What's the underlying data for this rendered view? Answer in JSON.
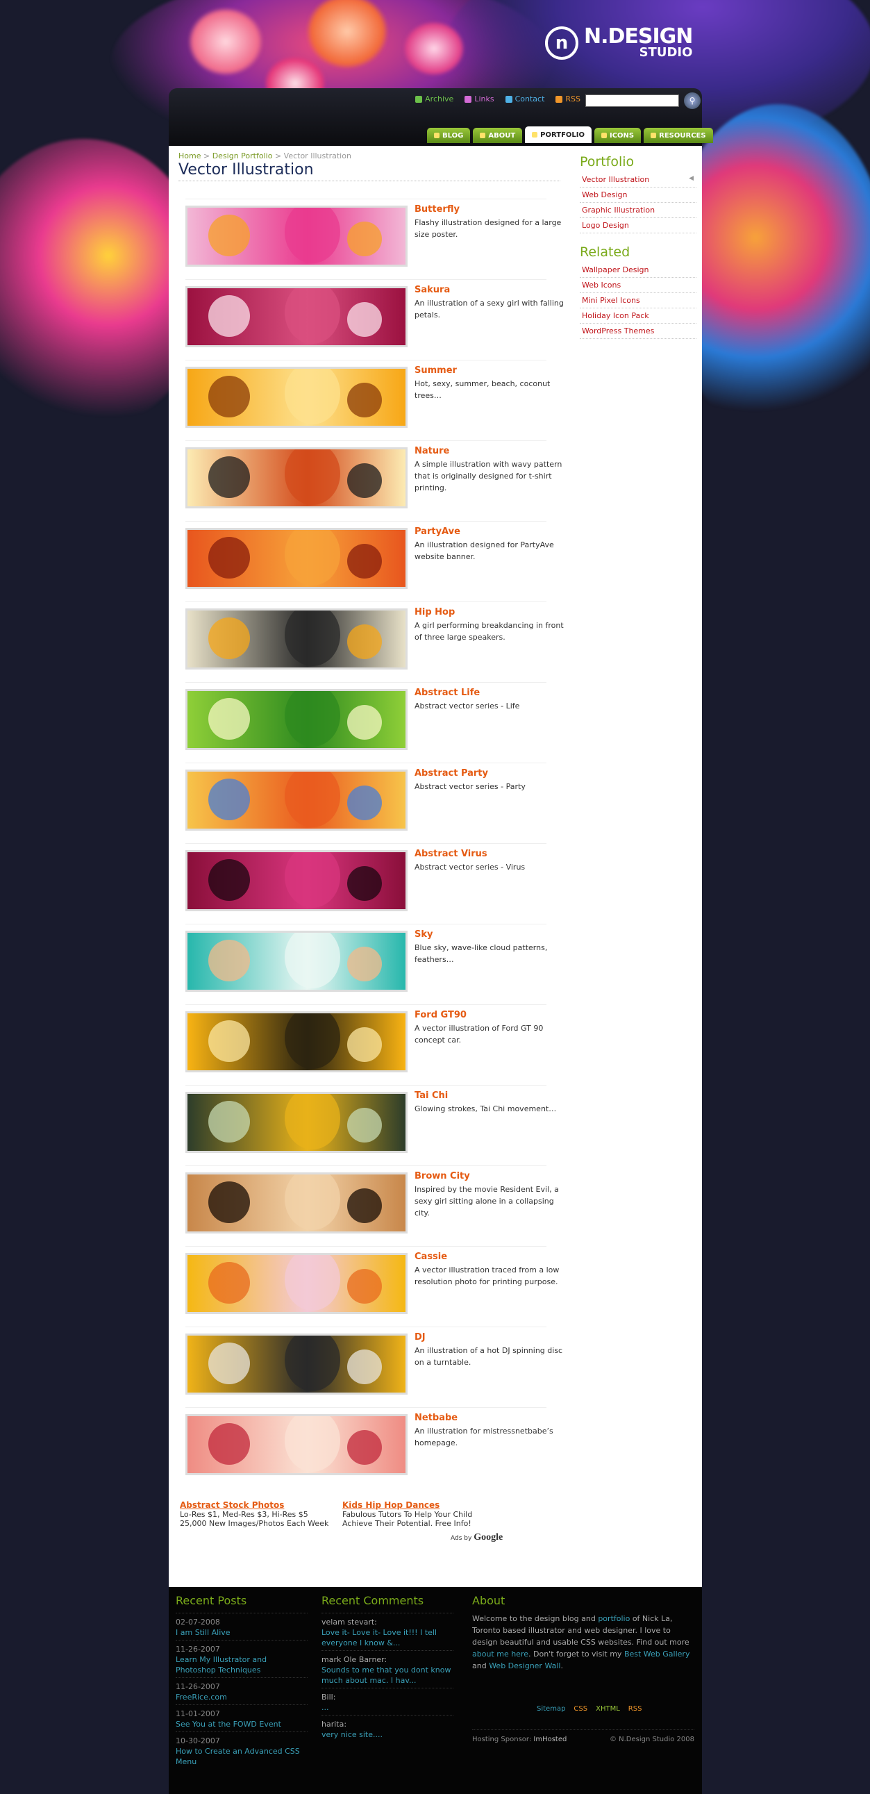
{
  "brand": {
    "name_line1": "N.DESIGN",
    "name_line2": "STUDIO",
    "mark": "n"
  },
  "toplinks": [
    {
      "label": "Archive",
      "icon": "archive-icon",
      "color": "#6cc04a"
    },
    {
      "label": "Links",
      "icon": "links-icon",
      "color": "#d36bd6"
    },
    {
      "label": "Contact",
      "icon": "contact-icon",
      "color": "#4fb1e6"
    },
    {
      "label": "RSS",
      "icon": "rss-icon",
      "color": "#f0962a"
    }
  ],
  "search": {
    "placeholder": ""
  },
  "tabs": [
    {
      "label": "BLOG",
      "active": false
    },
    {
      "label": "ABOUT",
      "active": false
    },
    {
      "label": "PORTFOLIO",
      "active": true
    },
    {
      "label": "ICONS",
      "active": false
    },
    {
      "label": "RESOURCES",
      "active": false
    }
  ],
  "breadcrumb": {
    "home": "Home",
    "sep": ">",
    "section": "Design Portfolio",
    "current": "Vector Illustration"
  },
  "page_title": "Vector Illustration",
  "items": [
    {
      "title": "Butterfly",
      "desc": "Flashy illustration designed for a large size poster.",
      "colors": [
        "#f2b7d6",
        "#ea3b8f",
        "#f7a12a"
      ]
    },
    {
      "title": "Sakura",
      "desc": "An illustration of a sexy girl with falling petals.",
      "colors": [
        "#9b1140",
        "#d94f7f",
        "#fbe0ea"
      ]
    },
    {
      "title": "Summer",
      "desc": "Hot, sexy, summer, beach, coconut trees…",
      "colors": [
        "#f7a716",
        "#fde08c",
        "#8c3d09"
      ]
    },
    {
      "title": "Nature",
      "desc": "A simple illustration with wavy pattern that is originally designed for t-shirt printing.",
      "colors": [
        "#fcebb3",
        "#d34b1b",
        "#1e1e1e"
      ]
    },
    {
      "title": "PartyAve",
      "desc": "An illustration designed for PartyAve website banner.",
      "colors": [
        "#e8561e",
        "#f7a23a",
        "#8a1f0c"
      ]
    },
    {
      "title": "Hip Hop",
      "desc": "A girl performing breakdancing in front of three large speakers.",
      "colors": [
        "#e8e1c8",
        "#2a2a2a",
        "#f6a71a"
      ]
    },
    {
      "title": "Abstract Life",
      "desc": "Abstract vector series - Life",
      "colors": [
        "#8fcf38",
        "#2e8a1f",
        "#f6f7c2"
      ]
    },
    {
      "title": "Abstract Party",
      "desc": "Abstract vector series - Party",
      "colors": [
        "#f7c44a",
        "#ea5b1f",
        "#4a7fd6"
      ]
    },
    {
      "title": "Abstract Virus",
      "desc": "Abstract vector series - Virus",
      "colors": [
        "#8a0f3a",
        "#d8357d",
        "#1b0510"
      ]
    },
    {
      "title": "Sky",
      "desc": "Blue sky, wave-like cloud patterns, feathers…",
      "colors": [
        "#27b7ac",
        "#e9f7f3",
        "#f3b98a"
      ]
    },
    {
      "title": "Ford GT90",
      "desc": "A vector illustration of Ford GT 90 concept car.",
      "colors": [
        "#f8b313",
        "#2c2410",
        "#fbe6a0"
      ]
    },
    {
      "title": "Tai Chi",
      "desc": "Glowing strokes, Tai Chi movement…",
      "colors": [
        "#2d3d2a",
        "#e8b21a",
        "#c5d8b0"
      ]
    },
    {
      "title": "Brown City",
      "desc": "Inspired by the movie Resident Evil, a sexy girl sitting alone in a collapsing city.",
      "colors": [
        "#c8874a",
        "#f2d2a8",
        "#1a0d06"
      ]
    },
    {
      "title": "Cassie",
      "desc": "A vector illustration traced from a low resolution photo for printing purpose.",
      "colors": [
        "#f5b813",
        "#f3c9d6",
        "#e86b1e"
      ]
    },
    {
      "title": "DJ",
      "desc": "An illustration of a hot DJ spinning disc on a turntable.",
      "colors": [
        "#f0b318",
        "#2a2a2a",
        "#e8e4dc"
      ]
    },
    {
      "title": "Netbabe",
      "desc": "An illustration for mistressnetbabe’s homepage.",
      "colors": [
        "#ef8c83",
        "#fbe2d4",
        "#c12a3c"
      ]
    }
  ],
  "ads": [
    {
      "title": "Abstract Stock Photos",
      "line1": "Lo-Res $1, Med-Res $3, Hi-Res $5",
      "line2": "25,000 New Images/Photos Each Week"
    },
    {
      "title": "Kids Hip Hop Dances",
      "line1": "Fabulous Tutors To Help Your Child",
      "line2": "Achieve Their Potential. Free Info!"
    }
  ],
  "ads_by": {
    "prefix": "Ads by",
    "brand": "Google"
  },
  "sidebar": {
    "portfolio_heading": "Portfolio",
    "portfolio": [
      "Vector Illustration",
      "Web Design",
      "Graphic Illustration",
      "Logo Design"
    ],
    "related_heading": "Related",
    "related": [
      "Wallpaper Design",
      "Web Icons",
      "Mini Pixel Icons",
      "Holiday Icon Pack",
      "WordPress Themes"
    ]
  },
  "footer": {
    "recent_posts_heading": "Recent Posts",
    "recent_posts": [
      {
        "date": "02-07-2008",
        "title": "I am Still Alive"
      },
      {
        "date": "11-26-2007",
        "title": "Learn My Illustrator and Photoshop Techniques"
      },
      {
        "date": "11-26-2007",
        "title": "FreeRice.com"
      },
      {
        "date": "11-01-2007",
        "title": "See You at the FOWD Event"
      },
      {
        "date": "10-30-2007",
        "title": "How to Create an Advanced CSS Menu"
      }
    ],
    "recent_comments_heading": "Recent Comments",
    "recent_comments": [
      {
        "name": "velam stevart:",
        "text": "Love it- Love it- Love it!!! I tell everyone I know &..."
      },
      {
        "name": "mark Ole Barner:",
        "text": "Sounds to me that you dont know much about mac. I hav..."
      },
      {
        "name": "Bill:",
        "text": "..."
      },
      {
        "name": "harita:",
        "text": "very nice site...."
      }
    ],
    "about_heading": "About",
    "about": {
      "p1": "Welcome to the design blog and ",
      "l1": "portfolio",
      "p2": " of Nick La, Toronto based illustrator and web designer. I love to design beautiful and usable CSS websites. Find out more ",
      "l2": "about me here",
      "p3": ". Don't forget to visit my ",
      "l3": "Best Web Gallery",
      "p4": " and ",
      "l4": "Web Designer Wall",
      "p5": "."
    },
    "badges": [
      {
        "label": "Sitemap",
        "color": "#3aa0b8"
      },
      {
        "label": "CSS",
        "color": "#f0962a"
      },
      {
        "label": "XHTML",
        "color": "#9ac83a"
      },
      {
        "label": "RSS",
        "color": "#f0962a"
      }
    ],
    "hosting_label": "Hosting Sponsor:",
    "hosting_name": "ImHosted",
    "copyright": "© N.Design Studio 2008"
  }
}
